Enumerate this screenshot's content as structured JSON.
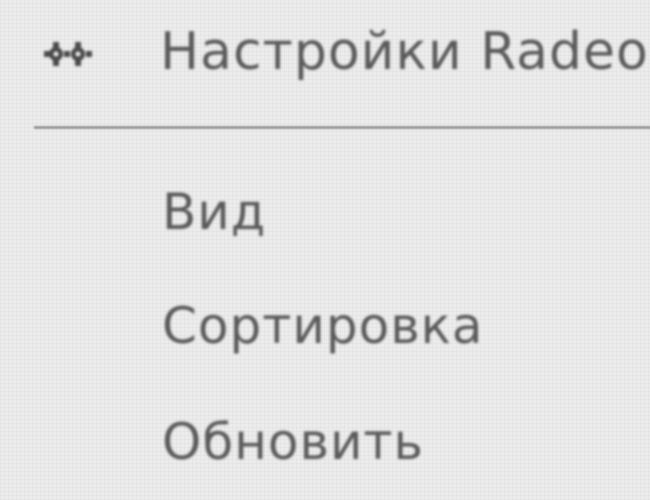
{
  "context_menu": {
    "header": {
      "icon": "radeon-gear-icon",
      "label": "Настройки Radeon"
    },
    "items": [
      {
        "label": "Вид"
      },
      {
        "label": "Сортировка"
      },
      {
        "label": "Обновить"
      }
    ]
  }
}
